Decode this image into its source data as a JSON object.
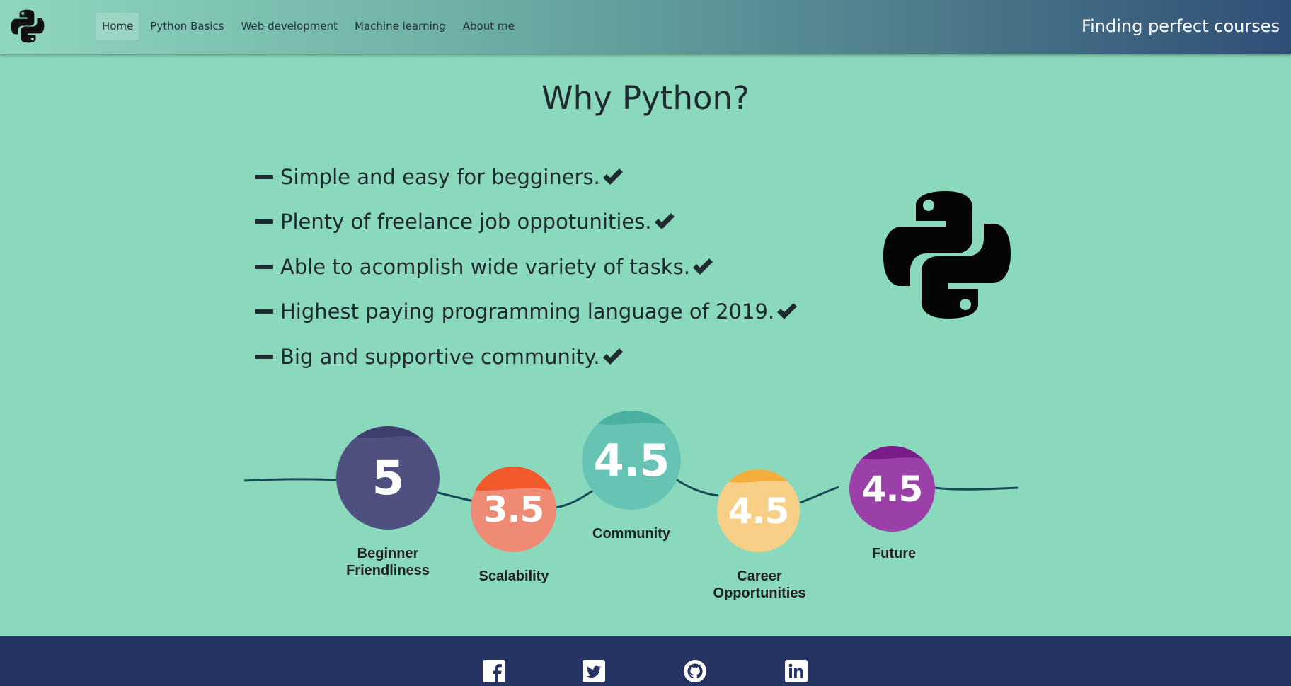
{
  "nav": {
    "logo_icon": "python-logo-icon",
    "links": [
      {
        "label": "Home",
        "active": true
      },
      {
        "label": "Python Basics",
        "active": false
      },
      {
        "label": "Web development",
        "active": false
      },
      {
        "label": "Machine learning",
        "active": false
      },
      {
        "label": "About me",
        "active": false
      }
    ],
    "tagline": "Finding perfect courses"
  },
  "main": {
    "title": "Why Python?",
    "reasons": [
      {
        "text": "Simple and easy for begginers."
      },
      {
        "text": "Plenty of freelance job oppotunities."
      },
      {
        "text": "Able to acomplish wide variety of tasks."
      },
      {
        "text": "Highest paying programming language of 2019."
      },
      {
        "text": "Big and supportive community."
      }
    ],
    "hero_icon": "python-logo-icon"
  },
  "ratings": [
    {
      "value": "5",
      "label_lines": [
        "Beginner",
        "Friendliness"
      ],
      "color": "#4f4f80",
      "cap_color": "#3f3f6e"
    },
    {
      "value": "3.5",
      "label_lines": [
        "Scalability"
      ],
      "color": "#ef8b75",
      "cap_color": "#f25a2e"
    },
    {
      "value": "4.5",
      "label_lines": [
        "Community"
      ],
      "color": "#67c3b3",
      "cap_color": "#49b0a2"
    },
    {
      "value": "4.5",
      "label_lines": [
        "Career",
        "Opportunities"
      ],
      "color": "#f8cf86",
      "cap_color": "#f5ae3c"
    },
    {
      "value": "4.5",
      "label_lines": [
        "Future"
      ],
      "color": "#9a40a8",
      "cap_color": "#7a1b8a"
    }
  ],
  "colors": {
    "background": "#8bd9bc",
    "footer": "#253463",
    "wave": "#174a5a"
  },
  "footer": {
    "social_icons": [
      "facebook-icon",
      "twitter-icon",
      "github-icon",
      "linkedin-icon"
    ]
  }
}
